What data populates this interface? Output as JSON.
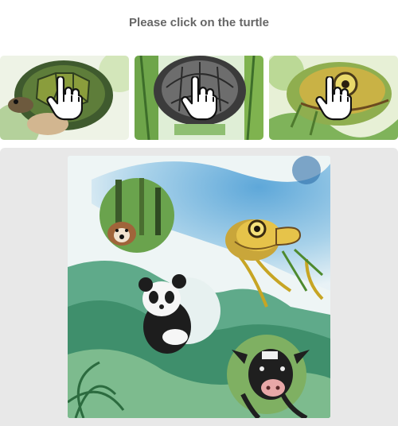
{
  "prompt": "Please click on the turtle",
  "thumbnails": [
    {
      "subject": "turtle-shell-green",
      "icon": "pointer-hand-icon"
    },
    {
      "subject": "turtle-shell-gray",
      "icon": "pointer-hand-icon"
    },
    {
      "subject": "turtle-head-closeup",
      "icon": "pointer-hand-icon"
    }
  ],
  "scene": {
    "objects": [
      "dog",
      "turtle",
      "panda",
      "cow"
    ]
  },
  "colors": {
    "panel_background": "#e8e8e8",
    "prompt_text": "#666666"
  }
}
